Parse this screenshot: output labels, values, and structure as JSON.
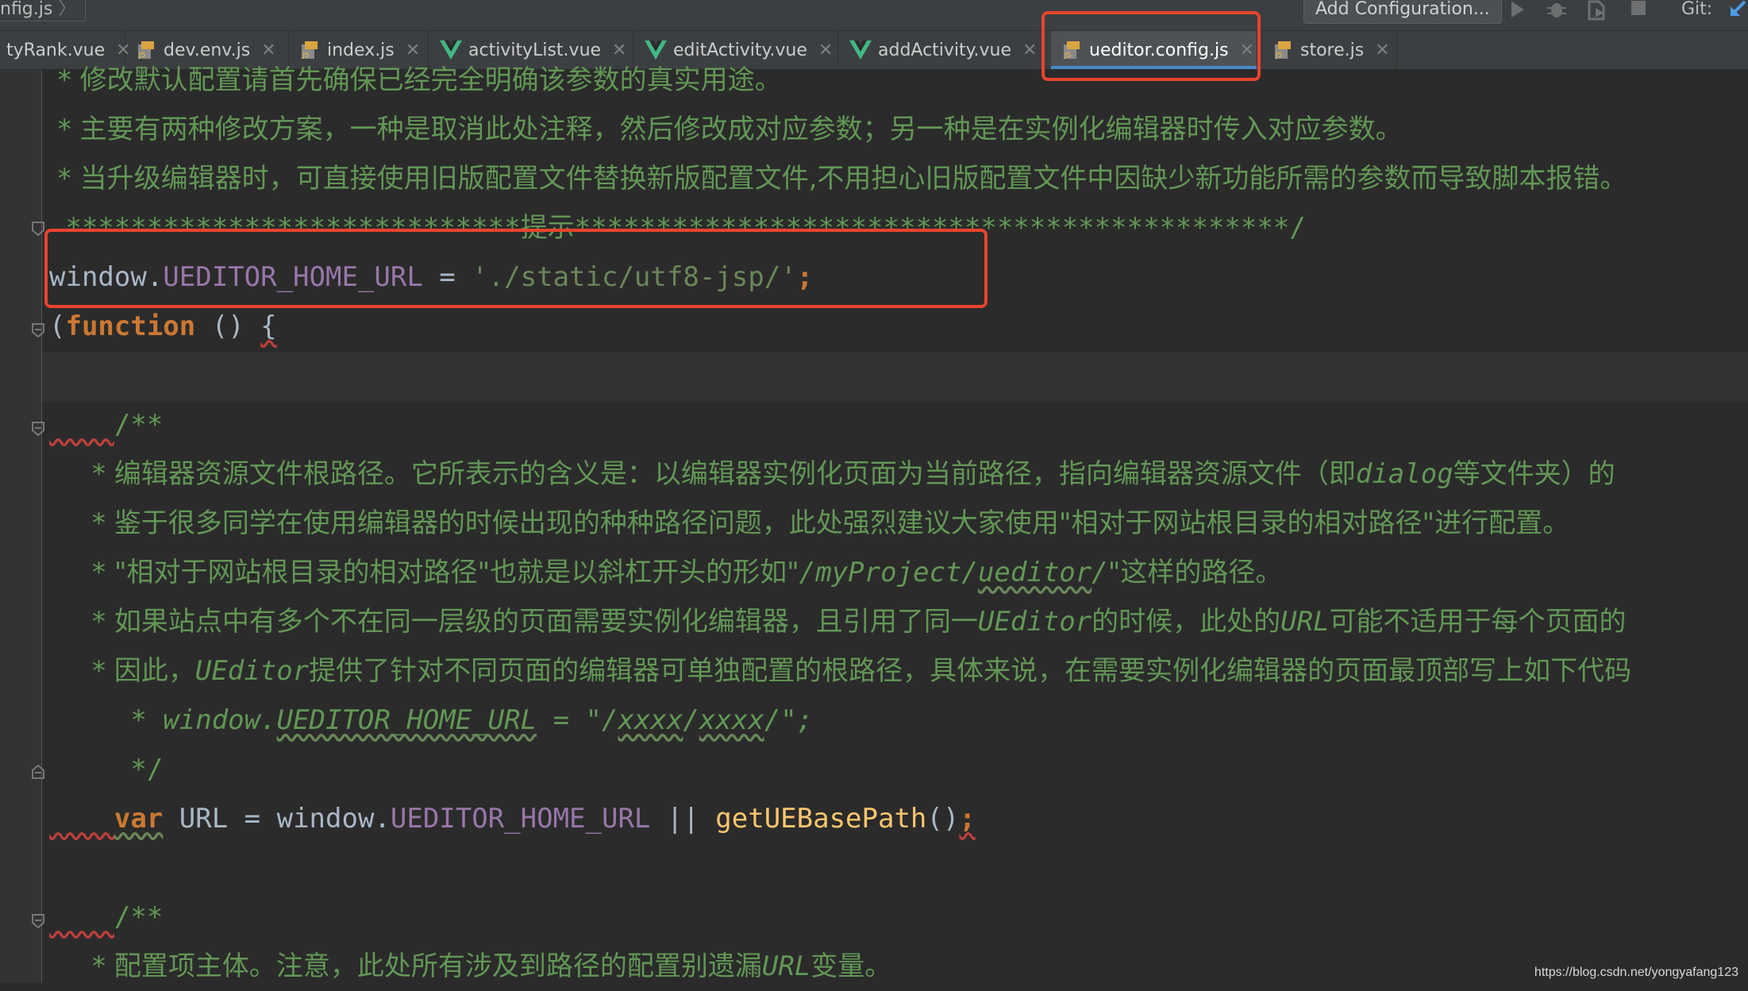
{
  "breadcrumb": "nfig.js",
  "toolbar": {
    "add_config_label": "Add Configuration...",
    "git_label": "Git:"
  },
  "tabs": [
    {
      "label": "tyRank.vue",
      "type": "vue"
    },
    {
      "label": "dev.env.js",
      "type": "js"
    },
    {
      "label": "index.js",
      "type": "js"
    },
    {
      "label": "activityList.vue",
      "type": "vue"
    },
    {
      "label": "editActivity.vue",
      "type": "vue"
    },
    {
      "label": "addActivity.vue",
      "type": "vue"
    },
    {
      "label": "ueditor.config.js",
      "type": "js",
      "active": true
    },
    {
      "label": "store.js",
      "type": "js"
    }
  ],
  "code": {
    "l1_comment": " * 修改默认配置请首先确保已经完全明确该参数的真实用途。",
    "l2_comment": " * 主要有两种修改方案，一种是取消此处注释，然后修改成对应参数；另一种是在实例化编辑器时传入对应参数。",
    "l3_comment": " * 当升级编辑器时，可直接使用旧版配置文件替换新版配置文件,不用担心旧版配置文件中因缺少新功能所需的参数而导致脚本报错。",
    "l4_stars_a": " ****************************提示",
    "l4_stars_b": "********************************************/",
    "l5_window": "window.",
    "l5_field": "UEDITOR_HOME_URL",
    "l5_eq": " = ",
    "l5_str": "'./static/utf8-jsp/'",
    "l5_semi": ";",
    "l6_paren": "(",
    "l6_kw": "function",
    "l6_rest": " () ",
    "l6_brace": "{",
    "l8_indent": "    ",
    "l8_doc": "/**",
    "l9_a": "     * 编辑器资源文件根路径。它所表示的含义是：以编辑器实例化页面为当前路径，指向编辑器资源文件（即",
    "l9_i": "dialog",
    "l9_b": "等文件夹）的",
    "l10": "     * 鉴于很多同学在使用编辑器的时候出现的种种路径问题，此处强烈建议大家使用\"相对于网站根目录的相对路径\"进行配置。",
    "l11_a": "     * \"相对于网站根目录的相对路径\"也就是以斜杠开头的形如\"",
    "l11_i1": "/myProject/",
    "l11_i2": "ueditor",
    "l11_i3": "/",
    "l11_b": "\"这样的路径。",
    "l12_a": "     * 如果站点中有多个不在同一层级的页面需要实例化编辑器，且引用了同一",
    "l12_i1": "UEditor",
    "l12_b": "的时候，此处的",
    "l12_i2": "URL",
    "l12_c": "可能不适用于每个页面的",
    "l13_a": "     * 因此，",
    "l13_i": "UEditor",
    "l13_b": "提供了针对不同页面的编辑器可单独配置的根路径，具体来说，在需要实例化编辑器的页面最顶部写上如下代码",
    "l14_a": "     * window.",
    "l14_u1": "UEDITOR_HOME_URL",
    "l14_b": " = \"/",
    "l14_u2": "xxxx",
    "l14_c": "/",
    "l14_u3": "xxxx",
    "l14_d": "/\";",
    "l15": "     */",
    "l16_indent": "    ",
    "l16_kw": "var",
    "l16_a": " URL = window.",
    "l16_field": "UEDITOR_HOME_URL",
    "l16_b": " || ",
    "l16_fn": "getUEBasePath",
    "l16_c": "()",
    "l16_semi": ";",
    "l18_indent": "    ",
    "l18_doc": "/**",
    "l19_a": "     * 配置项主体。注意，此处所有涉及到路径的配置别遗漏",
    "l19_i": "URL",
    "l19_b": "变量。"
  },
  "watermark": "https://blog.csdn.net/yongyafang123",
  "colors": {
    "editor_bg": "#2b2b2b",
    "comment": "#629755",
    "keyword": "#cc7832",
    "string": "#6a8759",
    "field": "#9876aa",
    "function": "#ffc66d",
    "highlight_box": "#e8442e",
    "active_tab_underline": "#4a88c7"
  }
}
